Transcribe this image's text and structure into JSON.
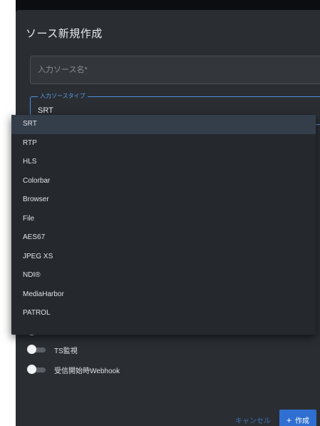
{
  "dialog": {
    "title": "ソース新規作成",
    "name_placeholder": "入力ソース名*",
    "type_select": {
      "label": "入力ソースタイプ",
      "value": "SRT"
    },
    "dropdown_options": [
      "SRT",
      "RTP",
      "HLS",
      "Colorbar",
      "Browser",
      "File",
      "AES67",
      "JPEG XS",
      "NDI®",
      "MediaHarbor",
      "PATROL"
    ],
    "toggles": [
      {
        "label": "",
        "on": false
      },
      {
        "label": "TS監視",
        "on": false
      },
      {
        "label": "受信開始時Webhook",
        "on": false
      }
    ],
    "buttons": {
      "cancel": "キャンセル",
      "create": "作成",
      "create_icon": "plus-icon"
    }
  },
  "colors": {
    "dialog_bg": "#2a2e33",
    "accent": "#4d8fe0",
    "primary_button": "#2f6fd1"
  }
}
